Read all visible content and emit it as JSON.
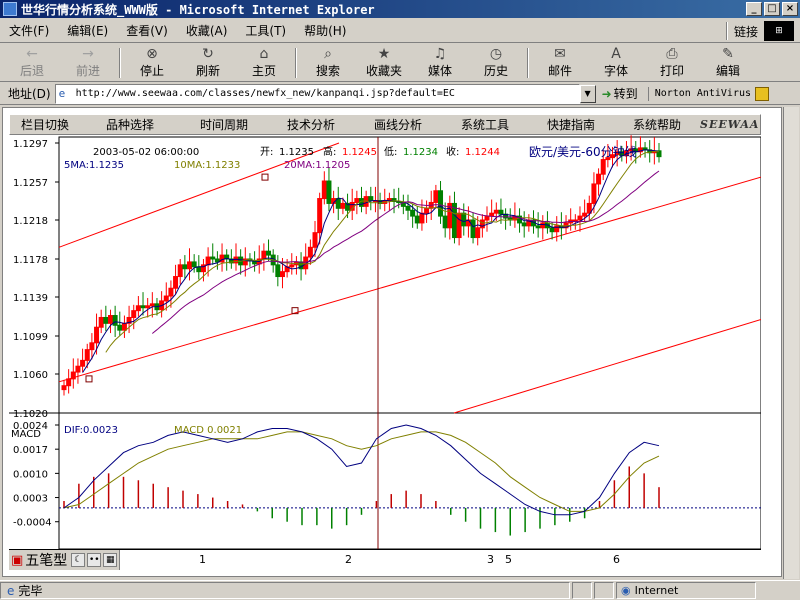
{
  "window": {
    "title": "世华行情分析系统_WWW版 - Microsoft Internet Explorer",
    "buttons": {
      "minimize": "_",
      "maximize": "□",
      "close": "×"
    }
  },
  "menu": {
    "items": [
      "文件(F)",
      "编辑(E)",
      "查看(V)",
      "收藏(A)",
      "工具(T)",
      "帮助(H)"
    ],
    "links_label": "链接"
  },
  "toolbar": {
    "buttons": [
      {
        "label": "后退",
        "icon": "back-arrow-icon",
        "glyph": "←",
        "disabled": true
      },
      {
        "label": "前进",
        "icon": "forward-arrow-icon",
        "glyph": "→",
        "disabled": true
      },
      {
        "label": "停止",
        "icon": "stop-icon",
        "glyph": "⊗",
        "disabled": false
      },
      {
        "label": "刷新",
        "icon": "refresh-icon",
        "glyph": "↻",
        "disabled": false
      },
      {
        "label": "主页",
        "icon": "home-icon",
        "glyph": "⌂",
        "disabled": false
      },
      {
        "label": "搜索",
        "icon": "search-icon",
        "glyph": "⌕",
        "disabled": false
      },
      {
        "label": "收藏夹",
        "icon": "favorites-icon",
        "glyph": "★",
        "disabled": false
      },
      {
        "label": "媒体",
        "icon": "media-icon",
        "glyph": "♫",
        "disabled": false
      },
      {
        "label": "历史",
        "icon": "history-icon",
        "glyph": "◷",
        "disabled": false
      },
      {
        "label": "邮件",
        "icon": "mail-icon",
        "glyph": "✉",
        "disabled": false
      },
      {
        "label": "字体",
        "icon": "font-icon",
        "glyph": "A",
        "disabled": false
      },
      {
        "label": "打印",
        "icon": "print-icon",
        "glyph": "⎙",
        "disabled": false
      },
      {
        "label": "编辑",
        "icon": "edit-icon",
        "glyph": "✎",
        "disabled": false
      }
    ]
  },
  "address": {
    "label": "地址(D)",
    "url": "http://www.seewaa.com/classes/newfx_new/kanpanqi.jsp?default=EC",
    "go_label": "转到",
    "norton_label": "Norton AntiVirus"
  },
  "app_menu": {
    "items": [
      "栏目切换",
      "品种选择",
      "时间周期",
      "技术分析",
      "画线分析",
      "系统工具",
      "快捷指南",
      "系统帮助"
    ],
    "logo": "SEEWAA"
  },
  "bottom_bar": {
    "ime_label": "五笔型",
    "date_markers": [
      "1",
      "2",
      "3",
      "5",
      "6"
    ]
  },
  "status": {
    "text": "完毕",
    "zone": "Internet"
  },
  "chart_data": [
    {
      "type": "candlestick",
      "title": "欧元/美元-60分钟线",
      "timestamp": "2003-05-02 06:00:00",
      "ohlc_labels": {
        "open_label": "开:",
        "open": "1.1235",
        "high_label": "高:",
        "high": "1.1245",
        "low_label": "低:",
        "low": "1.1234",
        "close_label": "收:",
        "close": "1.1244"
      },
      "ma_labels": [
        "5MA:1.1235",
        "10MA:1.1233",
        "20MA:1.1205"
      ],
      "y_ticks": [
        "1.1297",
        "1.1257",
        "1.1218",
        "1.1178",
        "1.1139",
        "1.1099",
        "1.1060",
        "1.1020"
      ],
      "ylim": [
        1.102,
        1.1297
      ],
      "colors": {
        "up": "#ff0000",
        "down": "#008000",
        "ma5": "#000080",
        "ma10": "#808000",
        "ma20": "#800080",
        "trend": "#ff0000",
        "cursor": "#800000"
      },
      "closes": [
        1.1048,
        1.1055,
        1.1062,
        1.1068,
        1.1074,
        1.1085,
        1.1092,
        1.1108,
        1.1118,
        1.1112,
        1.112,
        1.111,
        1.1105,
        1.1112,
        1.1118,
        1.1125,
        1.113,
        1.1128,
        1.113,
        1.1132,
        1.1126,
        1.1135,
        1.114,
        1.1148,
        1.116,
        1.1172,
        1.1168,
        1.1175,
        1.117,
        1.1165,
        1.1172,
        1.118,
        1.1178,
        1.1175,
        1.1182,
        1.1178,
        1.1174,
        1.118,
        1.1172,
        1.1178,
        1.1176,
        1.1173,
        1.1178,
        1.1186,
        1.1182,
        1.1172,
        1.116,
        1.1165,
        1.117,
        1.1172,
        1.1175,
        1.1168,
        1.118,
        1.119,
        1.1205,
        1.124,
        1.1258,
        1.1235,
        1.124,
        1.123,
        1.1235,
        1.1228,
        1.1236,
        1.124,
        1.1232,
        1.1242,
        1.1238,
        1.1238,
        1.1235,
        1.1238,
        1.124,
        1.1237,
        1.1236,
        1.1232,
        1.1228,
        1.1222,
        1.1215,
        1.1225,
        1.123,
        1.1236,
        1.1248,
        1.1222,
        1.121,
        1.1235,
        1.12,
        1.1225,
        1.1212,
        1.1218,
        1.12,
        1.121,
        1.1218,
        1.1222,
        1.1225,
        1.1228,
        1.1224,
        1.122,
        1.1218,
        1.1222,
        1.1215,
        1.1212,
        1.1218,
        1.1212,
        1.121,
        1.1215,
        1.121,
        1.1206,
        1.1212,
        1.121,
        1.1215,
        1.1218,
        1.1218,
        1.1222,
        1.1225,
        1.1235,
        1.1255,
        1.1265,
        1.128,
        1.1282,
        1.1285,
        1.1288,
        1.1284,
        1.1289,
        1.1291,
        1.1288,
        1.1292,
        1.129,
        1.1287,
        1.1289,
        1.1283
      ],
      "macd": {
        "labels": [
          "MACD",
          "DIF:0.0023",
          "MACD 0.0021"
        ],
        "y_ticks": [
          "0.0024",
          "0.0017",
          "0.0010",
          "0.0003",
          "-0.0004"
        ],
        "ylim": [
          -0.0009,
          0.0024
        ],
        "colors": {
          "dif": "#000080",
          "dea": "#808000",
          "hist_pos": "#c00000",
          "hist_neg": "#008000",
          "zero": "#000080"
        },
        "dif": [
          0.0,
          0.0003,
          0.0008,
          0.0012,
          0.0016,
          0.0018,
          0.0019,
          0.0021,
          0.0022,
          0.0021,
          0.002,
          0.0019,
          0.002,
          0.0022,
          0.0023,
          0.0023,
          0.0022,
          0.002,
          0.0017,
          0.0012,
          0.0013,
          0.002,
          0.0023,
          0.0024,
          0.0023,
          0.0021,
          0.0018,
          0.0014,
          0.001,
          0.0007,
          0.0004,
          0.0001,
          -0.0001,
          -0.0002,
          -0.0002,
          -0.0001,
          0.0003,
          0.001,
          0.0016,
          0.0019,
          0.0018
        ],
        "dea": [
          0.0,
          0.0001,
          0.0004,
          0.0007,
          0.001,
          0.0013,
          0.0015,
          0.0017,
          0.0018,
          0.0019,
          0.002,
          0.002,
          0.002,
          0.002,
          0.0021,
          0.0022,
          0.0022,
          0.0021,
          0.002,
          0.0018,
          0.0017,
          0.0018,
          0.002,
          0.0021,
          0.0022,
          0.0022,
          0.0021,
          0.0019,
          0.0016,
          0.0013,
          0.0009,
          0.0006,
          0.0003,
          0.0001,
          -0.0001,
          -0.0001,
          0.0,
          0.0004,
          0.0009,
          0.0013,
          0.0015
        ],
        "hist": [
          0.0002,
          0.0007,
          0.0009,
          0.001,
          0.0009,
          0.0008,
          0.0007,
          0.0006,
          0.0005,
          0.0004,
          0.0003,
          0.0002,
          0.0001,
          -0.0001,
          -0.0003,
          -0.0004,
          -0.0005,
          -0.0005,
          -0.0006,
          -0.0005,
          -0.0002,
          0.0002,
          0.0004,
          0.0005,
          0.0004,
          0.0002,
          -0.0002,
          -0.0004,
          -0.0006,
          -0.0007,
          -0.0008,
          -0.0007,
          -0.0006,
          -0.0005,
          -0.0004,
          -0.0003,
          0.0002,
          0.0008,
          0.0012,
          0.001,
          0.0006
        ]
      }
    }
  ]
}
